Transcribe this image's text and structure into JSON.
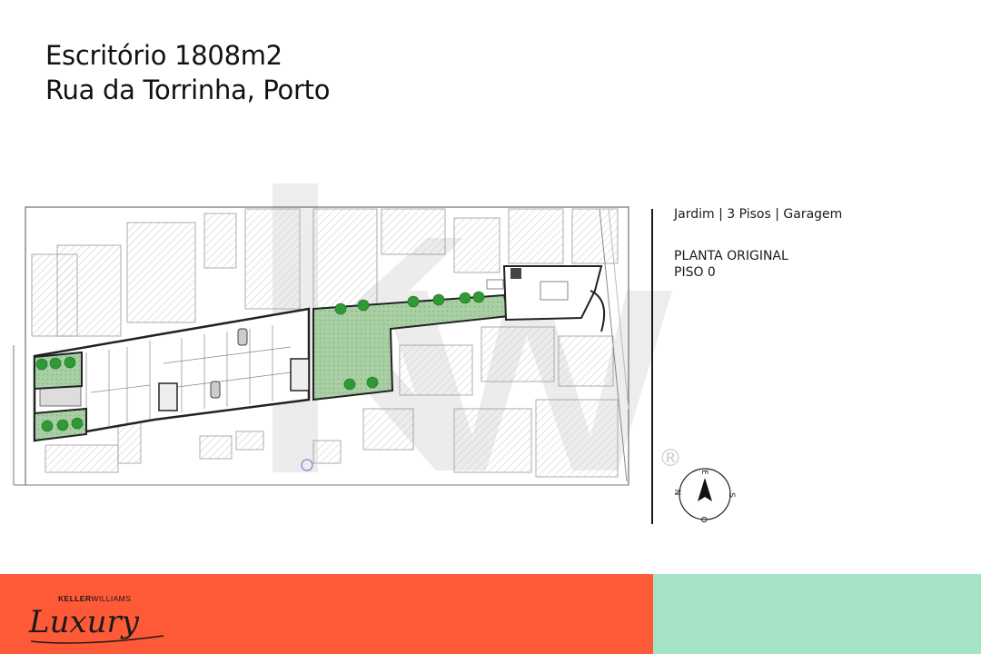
{
  "header": {
    "title_line1": "Escritório 1808m2",
    "title_line2": "Rua da Torrinha, Porto"
  },
  "info": {
    "features": "Jardim | 3 Pisos | Garagem",
    "plan_label": "PLANTA ORIGINAL",
    "floor_label": "PISO 0"
  },
  "compass": {
    "n": "N",
    "e": "E",
    "s": "S",
    "o": "O"
  },
  "watermark": {
    "mark": "®"
  },
  "footer": {
    "brand_top_bold": "KELLER",
    "brand_top": "WILLIAMS",
    "brand_script": "Luxury",
    "colors": {
      "left": "#ff5a37",
      "right": "#a6e3c5"
    }
  },
  "plan": {
    "colors": {
      "garden": "#9fc79b",
      "tree": "#2f9a34",
      "building": "#222222"
    }
  }
}
